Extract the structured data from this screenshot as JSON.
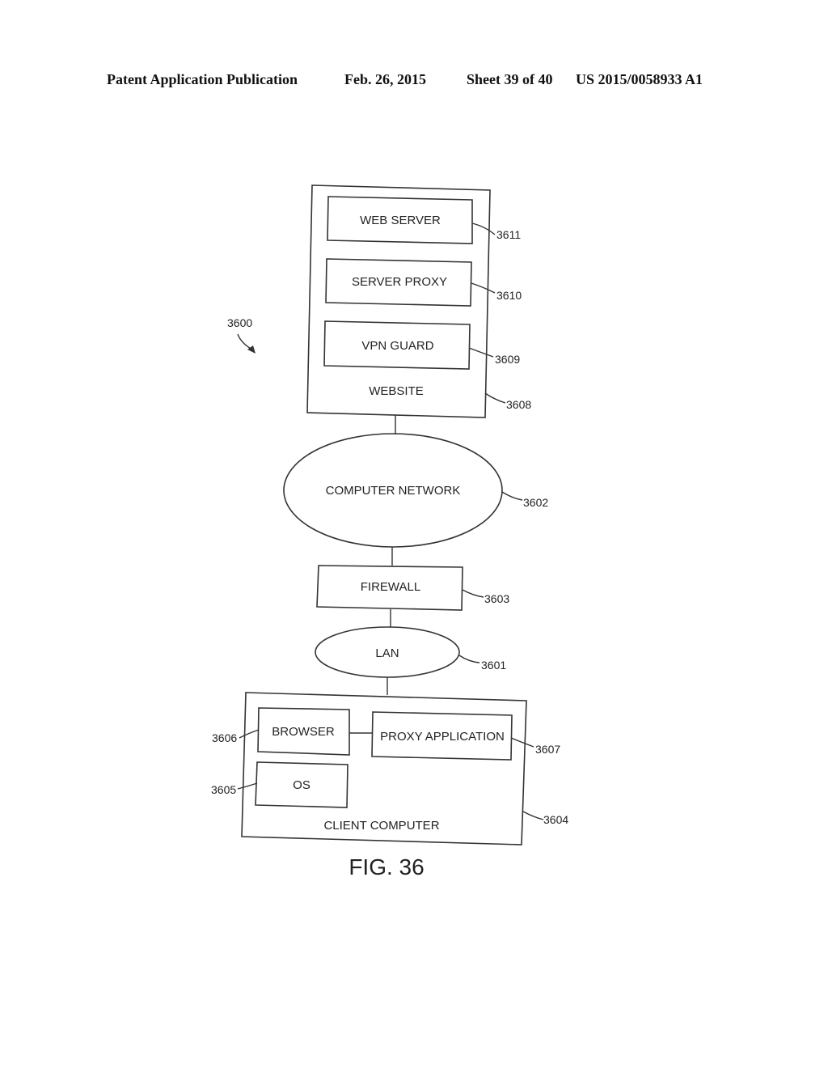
{
  "header": {
    "publication": "Patent Application Publication",
    "date": "Feb. 26, 2015",
    "sheet": "Sheet 39 of 40",
    "number": "US 2015/0058933 A1"
  },
  "diagram": {
    "system_ref": "3600",
    "website": {
      "label": "WEBSITE",
      "ref": "3608",
      "components": [
        {
          "label": "WEB SERVER",
          "ref": "3611"
        },
        {
          "label": "SERVER PROXY",
          "ref": "3610"
        },
        {
          "label": "VPN GUARD",
          "ref": "3609"
        }
      ]
    },
    "computer_network": {
      "label": "COMPUTER NETWORK",
      "ref": "3602"
    },
    "firewall": {
      "label": "FIREWALL",
      "ref": "3603"
    },
    "lan": {
      "label": "LAN",
      "ref": "3601"
    },
    "client_computer": {
      "label": "CLIENT COMPUTER",
      "ref": "3604",
      "browser": {
        "label": "BROWSER",
        "ref": "3606"
      },
      "proxy_application": {
        "label": "PROXY APPLICATION",
        "ref": "3607"
      },
      "os": {
        "label": "OS",
        "ref": "3605"
      }
    },
    "figure_caption": "FIG. 36"
  }
}
